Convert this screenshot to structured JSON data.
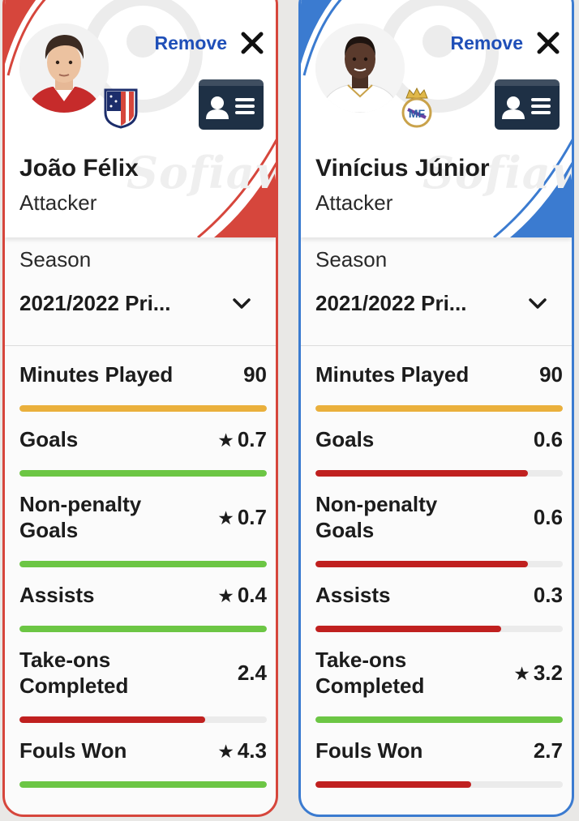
{
  "actions": {
    "remove_label": "Remove"
  },
  "watermark": "Sofiawka",
  "season_label": "Season",
  "stat_labels": [
    "Minutes Played",
    "Goals",
    "Non-penalty Goals",
    "Assists",
    "Take-ons Completed",
    "Fouls Won"
  ],
  "colors": {
    "good": "#6cc644",
    "bad": "#c0201f",
    "neutral": "#eab03c",
    "track": "#ebebeb"
  },
  "players": [
    {
      "name": "João Félix",
      "role": "Attacker",
      "club": "Atlético Madrid",
      "accent": "#d6463c",
      "season": "2021/2022 Pri...",
      "stats": [
        {
          "label": "Minutes Played",
          "value": "90",
          "star": false,
          "fill": 1.0,
          "rating": "neutral"
        },
        {
          "label": "Goals",
          "value": "0.7",
          "star": true,
          "fill": 1.0,
          "rating": "good"
        },
        {
          "label": "Non-penalty Goals",
          "value": "0.7",
          "star": true,
          "fill": 1.0,
          "rating": "good"
        },
        {
          "label": "Assists",
          "value": "0.4",
          "star": true,
          "fill": 1.0,
          "rating": "good"
        },
        {
          "label": "Take-ons Completed",
          "value": "2.4",
          "star": false,
          "fill": 0.75,
          "rating": "bad"
        },
        {
          "label": "Fouls Won",
          "value": "4.3",
          "star": true,
          "fill": 1.0,
          "rating": "good"
        }
      ]
    },
    {
      "name": "Vinícius Júnior",
      "role": "Attacker",
      "club": "Real Madrid",
      "accent": "#3b7bd0",
      "season": "2021/2022 Pri...",
      "stats": [
        {
          "label": "Minutes Played",
          "value": "90",
          "star": false,
          "fill": 1.0,
          "rating": "neutral"
        },
        {
          "label": "Goals",
          "value": "0.6",
          "star": false,
          "fill": 0.86,
          "rating": "bad"
        },
        {
          "label": "Non-penalty Goals",
          "value": "0.6",
          "star": false,
          "fill": 0.86,
          "rating": "bad"
        },
        {
          "label": "Assists",
          "value": "0.3",
          "star": false,
          "fill": 0.75,
          "rating": "bad"
        },
        {
          "label": "Take-ons Completed",
          "value": "3.2",
          "star": true,
          "fill": 1.0,
          "rating": "good"
        },
        {
          "label": "Fouls Won",
          "value": "2.7",
          "star": false,
          "fill": 0.63,
          "rating": "bad"
        }
      ]
    }
  ]
}
